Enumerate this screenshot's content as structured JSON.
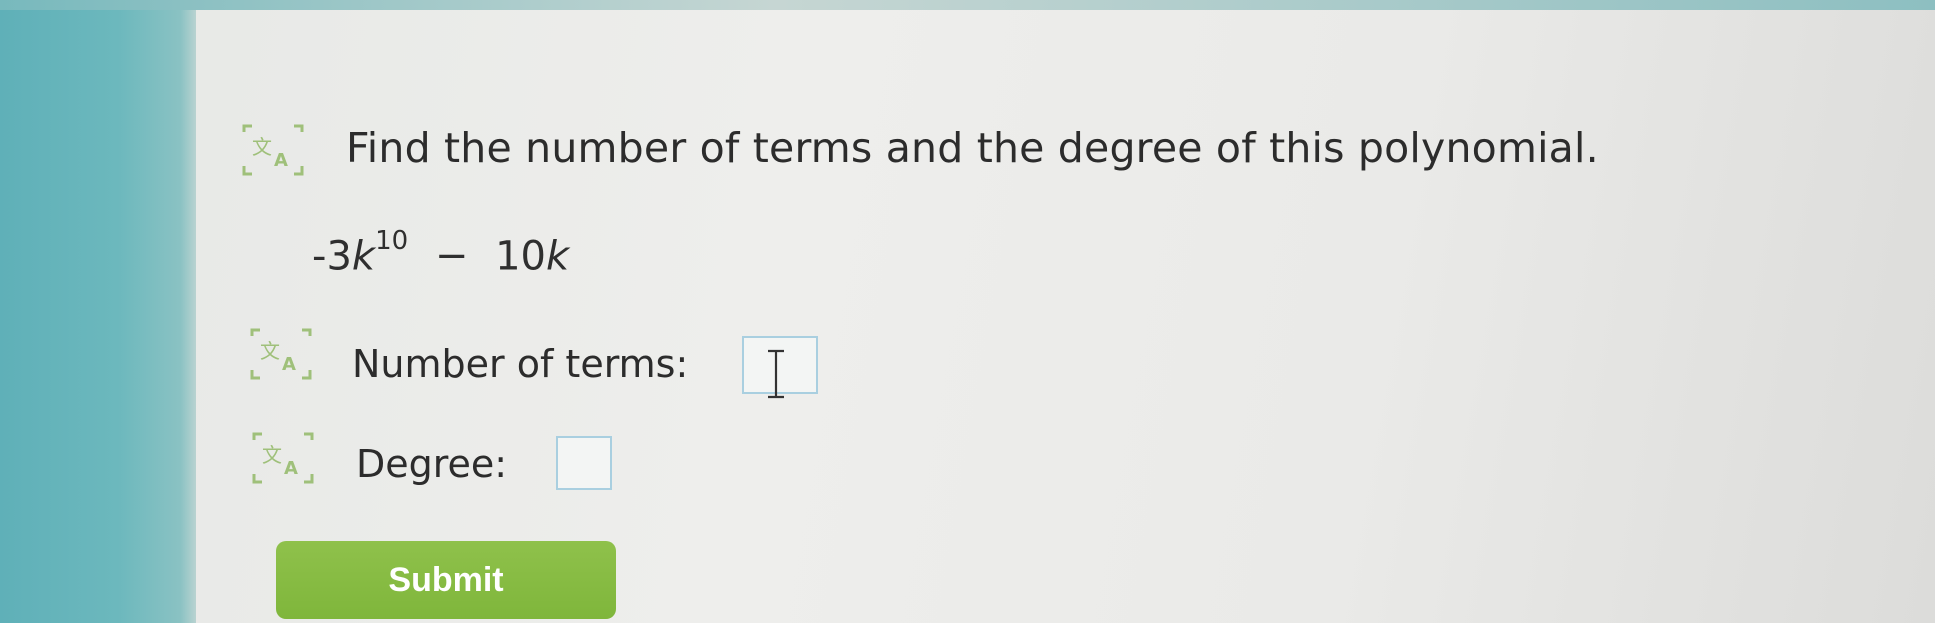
{
  "question": {
    "text": "Find the number of terms and the degree of this polynomial."
  },
  "polynomial": {
    "lead_sign": "-",
    "coef1": "3",
    "var1": "k",
    "exp1": "10",
    "operator": "−",
    "coef2": "10",
    "var2": "k"
  },
  "fields": {
    "terms_label": "Number of terms:",
    "terms_value": "",
    "degree_label": "Degree:",
    "degree_value": ""
  },
  "submit_label": "Submit",
  "icons": {
    "read_aloud": "translate-icon",
    "cursor": "text-cursor-icon"
  },
  "colors": {
    "accent_green": "#8fc14b",
    "icon_green": "#9fc07a",
    "box_border": "#a9cfe0"
  }
}
